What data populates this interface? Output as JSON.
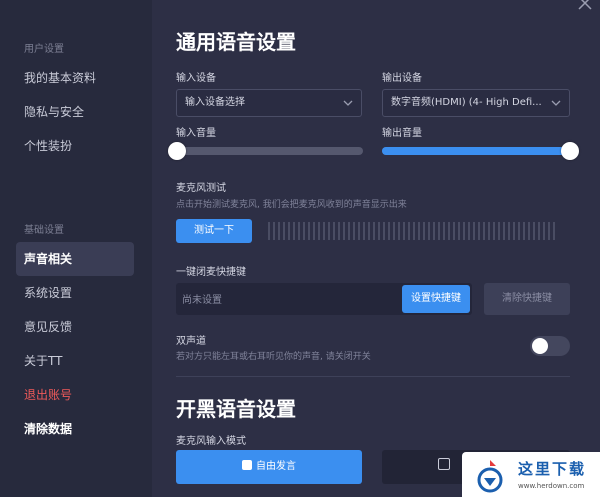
{
  "sidebar": {
    "group1": "用户设置",
    "group1_items": [
      "我的基本资料",
      "隐私与安全",
      "个性装扮"
    ],
    "group2": "基础设置",
    "group2_items": [
      "声音相关",
      "系统设置",
      "意见反馈",
      "关于TT"
    ],
    "logout": "退出账号",
    "clear": "清除数据",
    "active_item": "声音相关"
  },
  "main": {
    "title": "通用语音设置",
    "input_device_label": "输入设备",
    "input_device_value": "输入设备选择",
    "output_device_label": "输出设备",
    "output_device_value": "数字音频(HDMI) (4- High Defi...",
    "input_volume_label": "输入音量",
    "input_volume_value": 0,
    "output_volume_label": "输出音量",
    "output_volume_value": 1,
    "mic_test_label": "麦克风测试",
    "mic_test_desc": "点击开始测试麦克风, 我们会把麦克风收到的声音显示出来",
    "mic_test_button": "测试一下",
    "mute_hotkey_label": "一键闭麦快捷键",
    "mute_hotkey_placeholder": "尚未设置",
    "set_hotkey_button": "设置快捷键",
    "clear_hotkey_button": "清除快捷键",
    "stereo_label": "双声道",
    "stereo_desc": "若对方只能左耳或右耳听见你的声音, 请关闭开关",
    "stereo_enabled": false,
    "section2_title": "开黑语音设置",
    "mic_mode_label": "麦克风输入模式",
    "mode_free": "自由发言"
  },
  "watermark": {
    "title": "这里下载",
    "url": "www.herdown.com"
  },
  "colors": {
    "accent": "#3b8ff0",
    "danger": "#f05a5a",
    "background": "#2d2f45",
    "sidebar": "#272a3d"
  }
}
